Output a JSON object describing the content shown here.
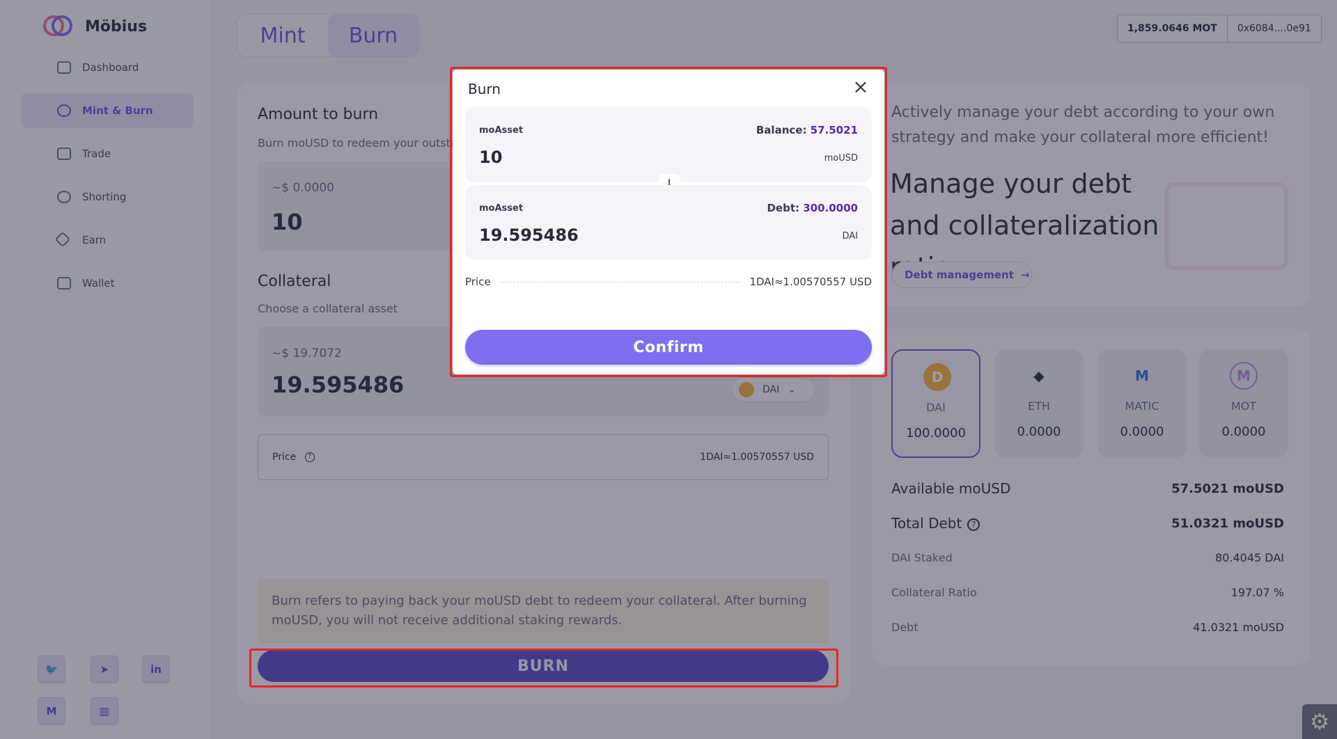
{
  "brand": {
    "name": "Möbius"
  },
  "sidebar": {
    "items": [
      {
        "label": "Dashboard",
        "icon": "folder-icon"
      },
      {
        "label": "Mint & Burn",
        "icon": "target-icon",
        "active": true
      },
      {
        "label": "Trade",
        "icon": "swap-icon"
      },
      {
        "label": "Shorting",
        "icon": "target-icon"
      },
      {
        "label": "Earn",
        "icon": "diamond-icon"
      },
      {
        "label": "Wallet",
        "icon": "wallet-icon"
      }
    ],
    "socials": [
      {
        "name": "twitter-icon",
        "glyph": "🐦"
      },
      {
        "name": "telegram-icon",
        "glyph": "➤"
      },
      {
        "name": "linkedin-icon",
        "glyph": "in"
      },
      {
        "name": "medium-icon",
        "glyph": "M"
      },
      {
        "name": "docs-icon",
        "glyph": "▥"
      }
    ]
  },
  "tabs": {
    "mint": "Mint",
    "burn": "Burn"
  },
  "wallet": {
    "balance": "1,859.0646 MOT",
    "address": "0x6084....0e91"
  },
  "main": {
    "amount_title": "Amount to burn",
    "amount_sub": "Burn moUSD to redeem your outstandi",
    "amount_usd": "~$ 0.0000",
    "amount_value": "10",
    "collateral_title": "Collateral",
    "collateral_sub": "Choose a collateral asset",
    "collateral_usd": "~$ 19.7072",
    "collateral_value": "19.595486",
    "asset_selected": "DAI",
    "price_label": "Price",
    "price_value": "1DAI≈1.00570557 USD",
    "notice": "Burn refers to paying back your moUSD debt to redeem your collateral. After burning moUSD, you will not receive additional staking rewards.",
    "burn_button": "BURN"
  },
  "info": {
    "desc": "Actively manage your debt according to your own strategy and make your collateral more efficient!",
    "headline": "Manage your debt and collateralization ratio",
    "debt_button": "Debt management"
  },
  "stats": {
    "coins": [
      {
        "name": "DAI",
        "amount": "100.0000",
        "color": "#f0b23c",
        "glyph": "D",
        "active": true
      },
      {
        "name": "ETH",
        "amount": "0.0000",
        "color": "#2a2a3c",
        "glyph": "◆"
      },
      {
        "name": "MATIC",
        "amount": "0.0000",
        "color": "#2a6fd6",
        "glyph": "M"
      },
      {
        "name": "MOT",
        "amount": "0.0000",
        "color": "#b48ad6",
        "glyph": "M"
      }
    ],
    "available_label": "Available moUSD",
    "available_value": "57.5021 moUSD",
    "total_debt_label": "Total Debt",
    "total_debt_value": "51.0321 moUSD",
    "staked_label": "DAI Staked",
    "staked_value": "80.4045 DAI",
    "ratio_label": "Collateral Ratio",
    "ratio_value": "197.07 %",
    "debt_label": "Debt",
    "debt_value": "41.0321 moUSD"
  },
  "modal": {
    "title": "Burn",
    "top_label": "moAsset",
    "balance_label": "Balance:",
    "balance_value": "57.5021",
    "top_value": "10",
    "top_unit": "moUSD",
    "bottom_label": "moAsset",
    "debt_label": "Debt:",
    "debt_value": "300.0000",
    "bottom_value": "19.595486",
    "bottom_unit": "DAI",
    "price_label": "Price",
    "price_value": "1DAI≈1.00570557 USD",
    "confirm": "Confirm"
  }
}
